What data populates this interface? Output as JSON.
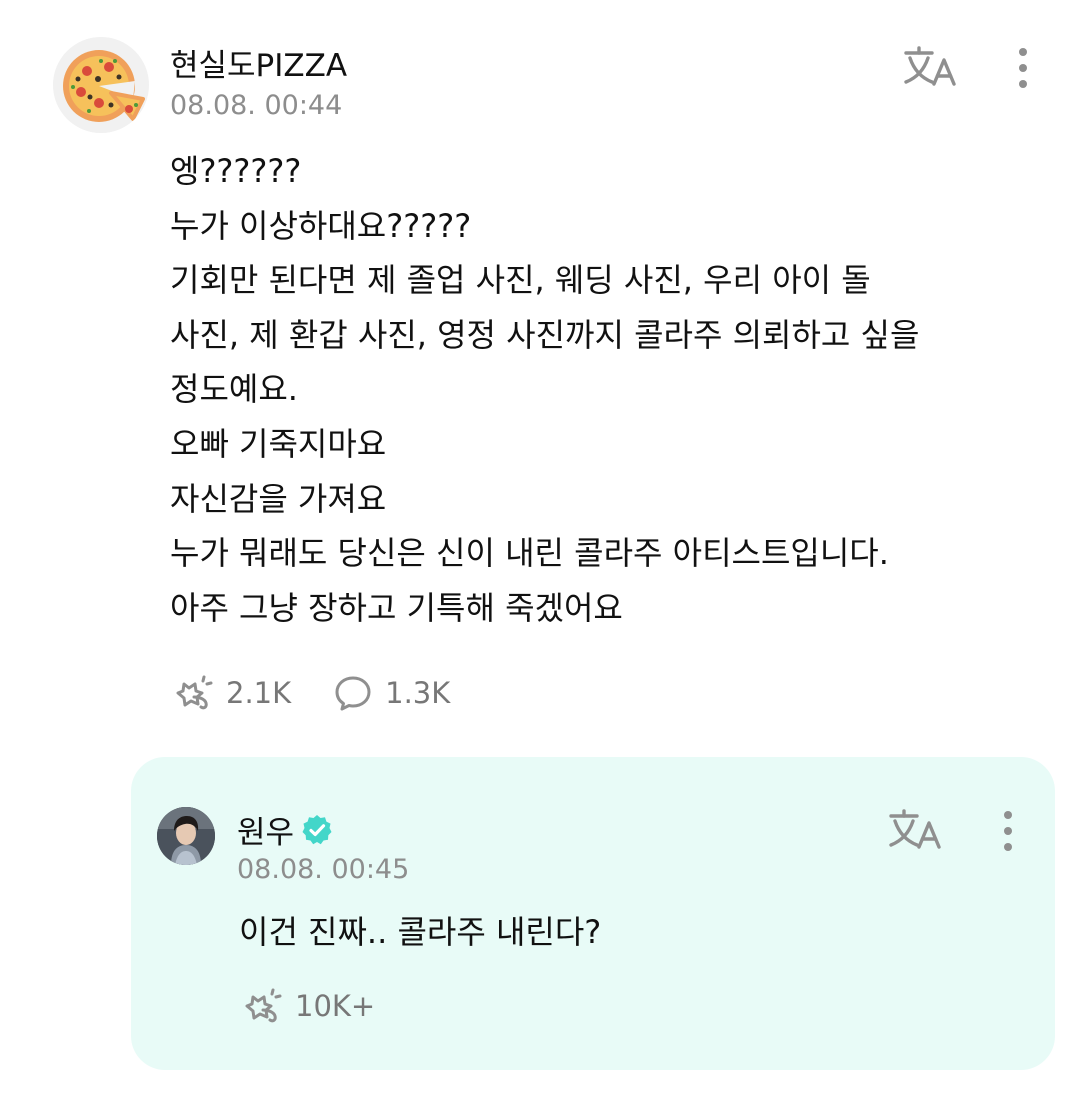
{
  "post": {
    "author": "현실도PIZZA",
    "timestamp": "08.08. 00:44",
    "lines": [
      "엥??????",
      "누가 이상하대요?????",
      "기회만 된다면 제 졸업 사진, 웨딩 사진, 우리 아이 돌",
      "사진, 제 환갑 사진, 영정 사진까지 콜라주 의뢰하고 싶을",
      "정도예요.",
      "오빠 기죽지마요",
      "자신감을 가져요",
      "누가 뭐래도 당신은 신이 내린 콜라주 아티스트입니다.",
      "아주 그냥 장하고 기특해 죽겠어요"
    ],
    "likes": "2.1K",
    "comments": "1.3K",
    "avatar_icon": "pizza-avatar",
    "translate_icon": "translate-icon",
    "more_icon": "more-vertical-icon"
  },
  "reply": {
    "author": "원우",
    "verified_icon": "verified-badge-icon",
    "verified_color": "#43d6c9",
    "timestamp": "08.08. 00:45",
    "text": "이건 진짜.. 콜라주 내린다?",
    "likes": "10K+",
    "background_color": "#e8fbf7",
    "translate_icon": "translate-icon",
    "more_icon": "more-vertical-icon"
  },
  "colors": {
    "text": "#111111",
    "muted": "#8d8d8d",
    "icon": "#8f8f8f"
  }
}
